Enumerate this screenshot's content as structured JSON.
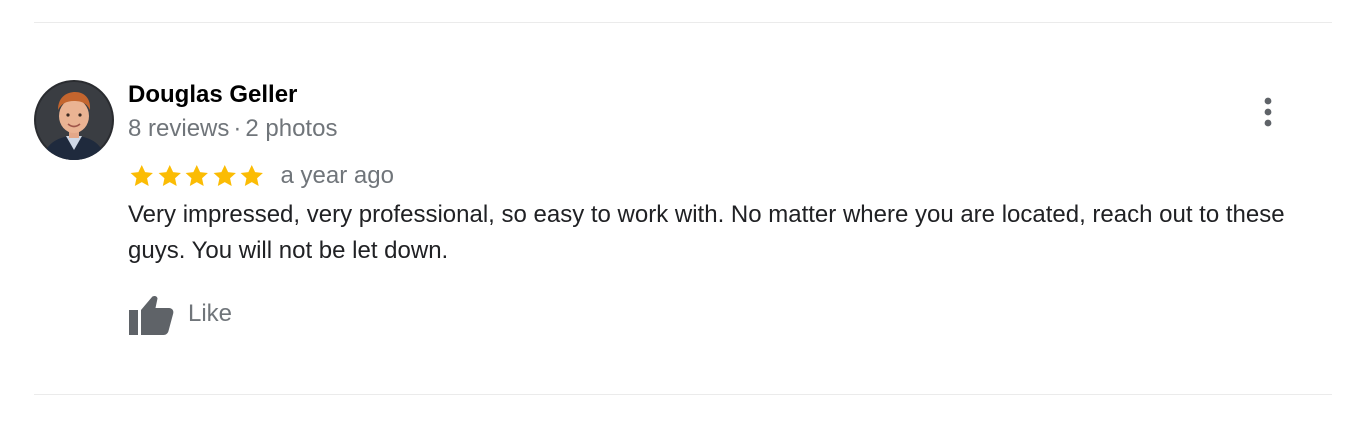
{
  "review": {
    "reviewer_name": "Douglas Geller",
    "reviews_count": "8 reviews",
    "separator": "·",
    "photos_count": "2 photos",
    "rating": 5,
    "max_rating": 5,
    "date": "a year ago",
    "text": "Very impressed, very professional, so easy to work with. No matter where you are located, reach out to these guys. You will not be let down.",
    "like_label": "Like"
  },
  "icons": {
    "more": "more-vertical-icon",
    "like": "thumbs-up-icon",
    "star": "star-icon"
  },
  "colors": {
    "star": "#fbbc04",
    "meta_text": "#70757a",
    "icon": "#5f6368",
    "divider": "#ebebeb"
  }
}
